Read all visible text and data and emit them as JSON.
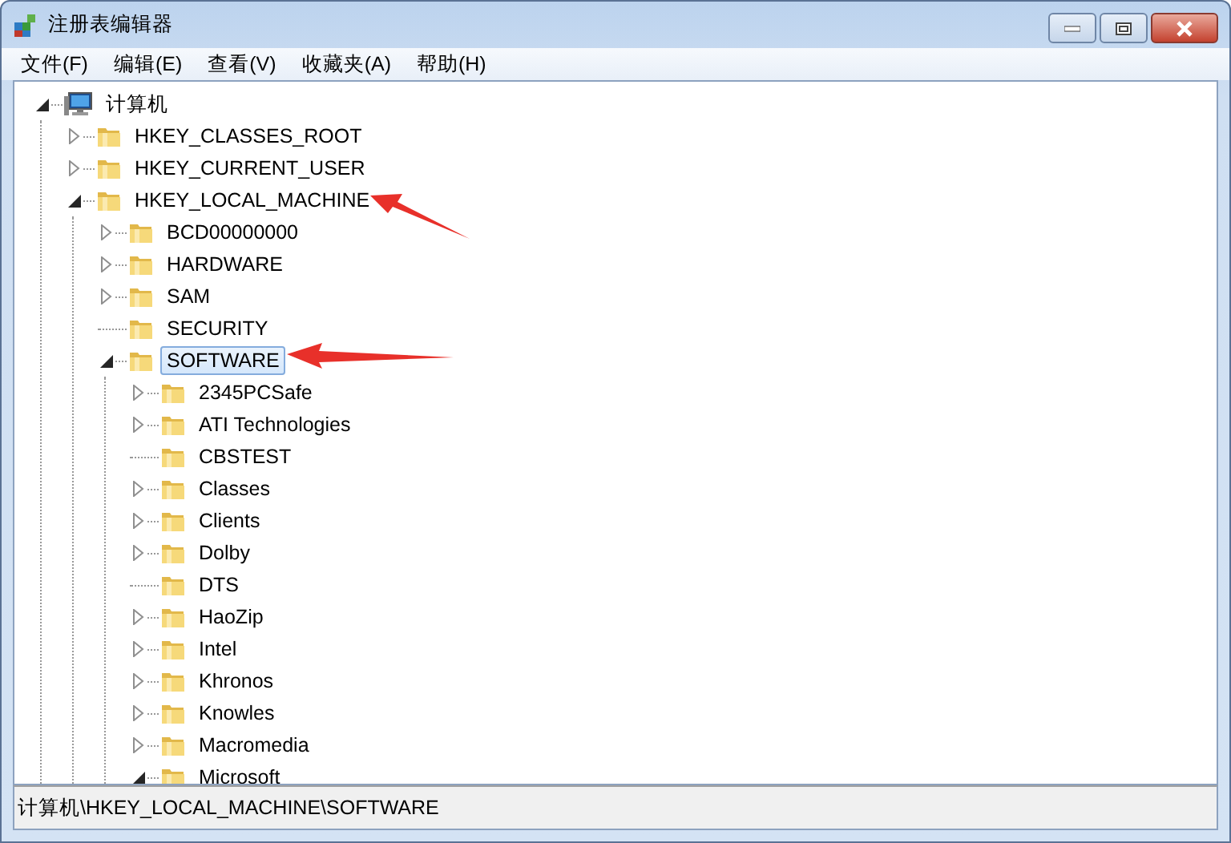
{
  "window": {
    "title": "注册表编辑器"
  },
  "menu": [
    "文件(F)",
    "编辑(E)",
    "查看(V)",
    "收藏夹(A)",
    "帮助(H)"
  ],
  "tree": [
    {
      "label": "计算机",
      "kind": "computer",
      "has_children": true,
      "expanded": true,
      "selected": false,
      "marked": false,
      "children": [
        {
          "label": "HKEY_CLASSES_ROOT",
          "kind": "folder",
          "has_children": true,
          "expanded": false,
          "selected": false,
          "marked": false
        },
        {
          "label": "HKEY_CURRENT_USER",
          "kind": "folder",
          "has_children": true,
          "expanded": false,
          "selected": false,
          "marked": false
        },
        {
          "label": "HKEY_LOCAL_MACHINE",
          "kind": "folder",
          "has_children": true,
          "expanded": true,
          "selected": false,
          "marked": true,
          "children": [
            {
              "label": "BCD00000000",
              "kind": "folder",
              "has_children": true,
              "expanded": false,
              "selected": false,
              "marked": false
            },
            {
              "label": "HARDWARE",
              "kind": "folder",
              "has_children": true,
              "expanded": false,
              "selected": false,
              "marked": false
            },
            {
              "label": "SAM",
              "kind": "folder",
              "has_children": true,
              "expanded": false,
              "selected": false,
              "marked": false
            },
            {
              "label": "SECURITY",
              "kind": "folder",
              "has_children": false,
              "selected": false,
              "marked": false
            },
            {
              "label": "SOFTWARE",
              "kind": "folder",
              "has_children": true,
              "expanded": true,
              "selected": true,
              "marked": true,
              "children": [
                {
                  "label": "2345PCSafe",
                  "kind": "folder",
                  "has_children": true,
                  "expanded": false,
                  "selected": false,
                  "marked": false
                },
                {
                  "label": "ATI Technologies",
                  "kind": "folder",
                  "has_children": true,
                  "expanded": false,
                  "selected": false,
                  "marked": false
                },
                {
                  "label": "CBSTEST",
                  "kind": "folder",
                  "has_children": false,
                  "selected": false,
                  "marked": false
                },
                {
                  "label": "Classes",
                  "kind": "folder",
                  "has_children": true,
                  "expanded": false,
                  "selected": false,
                  "marked": false
                },
                {
                  "label": "Clients",
                  "kind": "folder",
                  "has_children": true,
                  "expanded": false,
                  "selected": false,
                  "marked": false
                },
                {
                  "label": "Dolby",
                  "kind": "folder",
                  "has_children": true,
                  "expanded": false,
                  "selected": false,
                  "marked": false
                },
                {
                  "label": "DTS",
                  "kind": "folder",
                  "has_children": false,
                  "selected": false,
                  "marked": false
                },
                {
                  "label": "HaoZip",
                  "kind": "folder",
                  "has_children": true,
                  "expanded": false,
                  "selected": false,
                  "marked": false
                },
                {
                  "label": "Intel",
                  "kind": "folder",
                  "has_children": true,
                  "expanded": false,
                  "selected": false,
                  "marked": false
                },
                {
                  "label": "Khronos",
                  "kind": "folder",
                  "has_children": true,
                  "expanded": false,
                  "selected": false,
                  "marked": false
                },
                {
                  "label": "Knowles",
                  "kind": "folder",
                  "has_children": true,
                  "expanded": false,
                  "selected": false,
                  "marked": false
                },
                {
                  "label": "Macromedia",
                  "kind": "folder",
                  "has_children": true,
                  "expanded": false,
                  "selected": false,
                  "marked": false
                },
                {
                  "label": "Microsoft",
                  "kind": "folder",
                  "has_children": true,
                  "expanded": true,
                  "selected": false,
                  "marked": false
                }
              ]
            }
          ]
        }
      ]
    }
  ],
  "status_bar": "计算机\\HKEY_LOCAL_MACHINE\\SOFTWARE"
}
